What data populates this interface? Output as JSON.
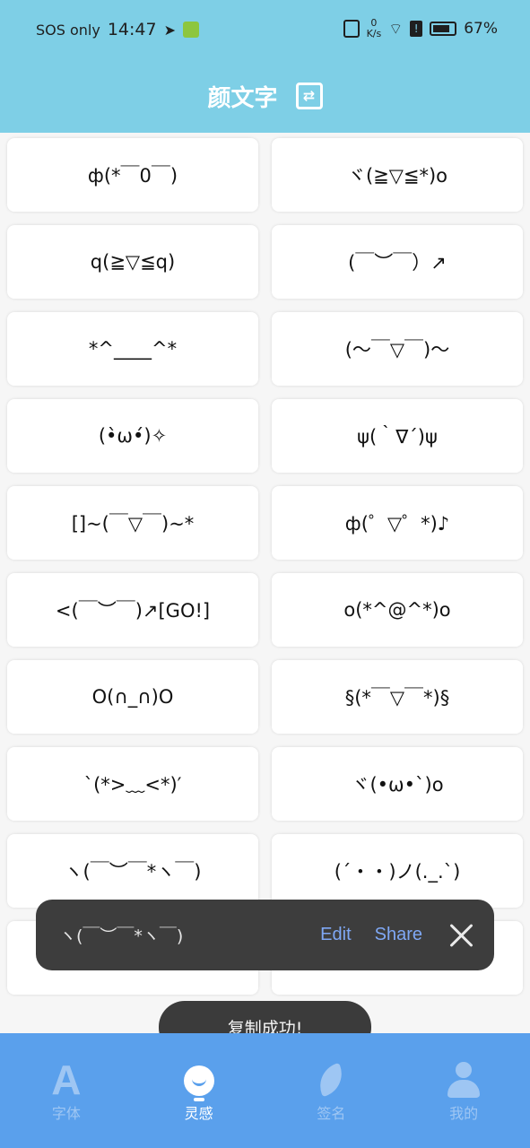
{
  "status_bar": {
    "network": "SOS only",
    "time": "14:47",
    "speed_value": "0",
    "speed_unit": "K/s",
    "battery": "67%"
  },
  "header": {
    "title": "颜文字",
    "action_icon": "switch-icon"
  },
  "kaomoji": [
    "ф(*￣0￣)",
    "ヾ(≧▽≦*)o",
    "q(≧▽≦q)",
    "(￣︶￣）↗",
    "*^____^*",
    "(～￣▽￣)～",
    "(•̀ω•́)✧",
    "ψ(｀∇´)ψ",
    "[]~(￣▽￣)~*",
    "ф(゜▽゜*)♪",
    "<(￣︶￣)↗[GO!]",
    "o(*^@^*)o",
    "O(∩_∩)O",
    "§(*￣▽￣*)§",
    "`(*>﹏<*)′",
    "ヾ(•ω•`)o",
    "ヽ(￣︶￣*ヽ￣)",
    "(´・・)ノ(._.`)",
    "",
    ""
  ],
  "snackbar": {
    "text": "ヽ(￣︶￣*ヽ￣)",
    "edit_label": "Edit",
    "share_label": "Share"
  },
  "toast": {
    "text": "复制成功!"
  },
  "nav": {
    "items": [
      {
        "label": "字体",
        "icon": "font-a-icon"
      },
      {
        "label": "灵感",
        "icon": "lightbulb-icon"
      },
      {
        "label": "签名",
        "icon": "feather-icon"
      },
      {
        "label": "我的",
        "icon": "user-icon"
      }
    ],
    "active_index": 1
  },
  "colors": {
    "header": "#7ecfe6",
    "nav": "#5aa0ec",
    "snackbar": "#3d3d3d",
    "snack_action": "#7fa8f5"
  }
}
